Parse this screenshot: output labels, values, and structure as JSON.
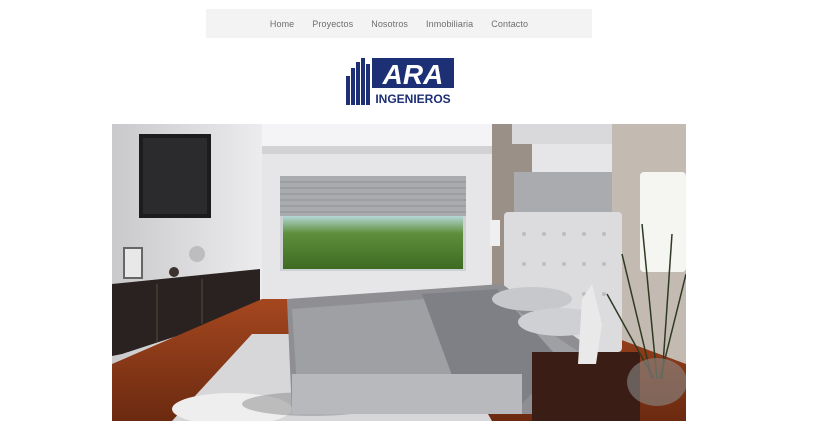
{
  "nav": {
    "items": [
      {
        "label": "Home"
      },
      {
        "label": "Proyectos"
      },
      {
        "label": "Nosotros"
      },
      {
        "label": "Inmobiliaria"
      },
      {
        "label": "Contacto"
      }
    ]
  },
  "brand": {
    "logo_letters": "ARA",
    "logo_subtitle": "INGENIEROS",
    "primary_color": "#1d2f75"
  },
  "hero": {
    "image_subject": "bedroom-interior-render"
  }
}
